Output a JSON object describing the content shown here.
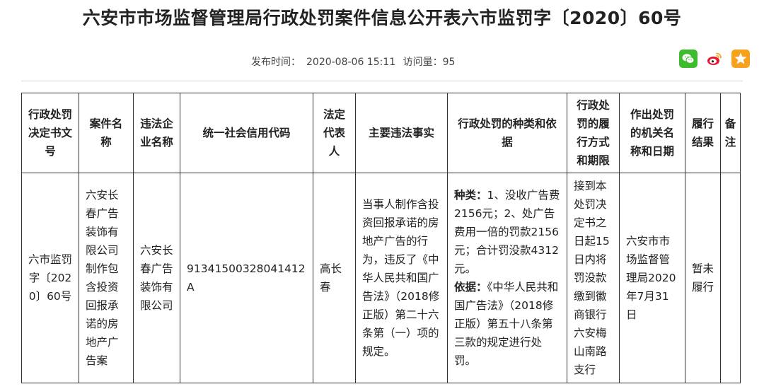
{
  "page": {
    "title": "六安市市场监督管理局行政处罚案件信息公开表六市监罚字〔2020〕60号",
    "publish_label": "发布时间：",
    "publish_time": "2020-08-06 15:11",
    "views_label": "访问量：",
    "views": "95"
  },
  "share": {
    "icons": [
      "wechat-icon",
      "weibo-icon",
      "qzone-icon"
    ],
    "colors": {
      "wechat": "#3ebb2e",
      "weibo": "#e6162d",
      "qzone": "#f6a21c"
    }
  },
  "table": {
    "headers": [
      "行政处罚决定书文号",
      "案件名称",
      "违法企业名称",
      "统一社会信用代码",
      "法定代表人",
      "主要违法事实",
      "行政处罚的种类和依据",
      "行政处罚的履行方式和期限",
      "作出处罚的机关名称和日期",
      "履行结果",
      "备注"
    ],
    "row": {
      "decision_no": "六市监罚字〔2020〕60号",
      "case_name": "六安长春广告装饰有限公司制作包含投资回报承诺的房地产广告案",
      "company": "六安长春广告装饰有限公司",
      "credit_code": "91341500328041412A",
      "legal_rep": "高长春",
      "facts": "当事人制作含投资回报承诺的房地产广告的行为，违反了《中华人民共和国广告法》（2018修正版）第二十六条第（一）项的规定。",
      "penalty_type_label": "种类：",
      "penalty_type": "1、没收广告费2156元；2、处广告费用一倍的罚款2156元；合计罚没款4312元。",
      "penalty_basis_label": "依据：",
      "penalty_basis": "《中华人民共和国广告法》（2018修正版）第五十八条第三款的规定进行处罚。",
      "performance": "接到本处罚决定书之日起15日内将罚没款缴到徽商银行六安梅山南路支行",
      "authority": "六安市市场监督管理局2020年7月31日",
      "result": "暂未履行",
      "remark": ""
    }
  }
}
